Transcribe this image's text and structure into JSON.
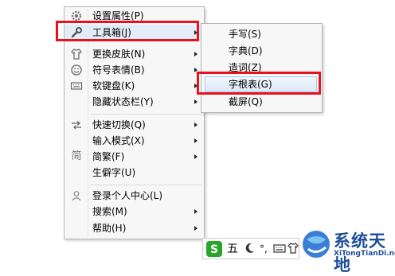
{
  "main_menu": {
    "items": [
      {
        "label": "设置属性(P)",
        "icon": "gear-icon",
        "submenu": false
      },
      {
        "label": "工具箱(J)",
        "icon": "wrench-icon",
        "submenu": true
      },
      {
        "label": "更换皮肤(N)",
        "icon": "shirt-icon",
        "submenu": true
      },
      {
        "label": "符号表情(B)",
        "icon": "smiley-icon",
        "submenu": true
      },
      {
        "label": "软键盘(K)",
        "icon": "keyboard-icon",
        "submenu": true
      },
      {
        "label": "隐藏状态栏(Y)",
        "icon": "",
        "submenu": true
      },
      {
        "label": "快速切换(Q)",
        "icon": "switch-arrows-icon",
        "submenu": true
      },
      {
        "label": "输入模式(X)",
        "icon": "",
        "submenu": true
      },
      {
        "label": "简繁(F)",
        "icon": "simplified-char-icon",
        "icon_text": "简",
        "submenu": true
      },
      {
        "label": "生僻字(U)",
        "icon": "",
        "submenu": false
      },
      {
        "label": "登录个人中心(L)",
        "icon": "user-icon",
        "submenu": false
      },
      {
        "label": "搜索(M)",
        "icon": "",
        "submenu": true
      },
      {
        "label": "帮助(H)",
        "icon": "",
        "submenu": true
      }
    ]
  },
  "toolbox_submenu": {
    "items": [
      {
        "label": "手写(S)"
      },
      {
        "label": "字典(D)"
      },
      {
        "label": "造词(Z)"
      },
      {
        "label": "字根表(G)"
      },
      {
        "label": "截屏(Q)"
      }
    ]
  },
  "ime_toolbar": {
    "logo_icon": "sogou-s-logo-icon",
    "mode_label": "五",
    "moon_icon": "moon-icon",
    "punct_label": "°,",
    "keyboard_icon": "keyboard-icon",
    "shirt_icon": "shirt-icon"
  },
  "watermark": {
    "title": "系统天地",
    "url": "XiTongTianDi.net"
  },
  "colors": {
    "highlight_box": "#e5131d",
    "selected_item_bg": "#dde9f8",
    "brand_blue": "#1f4d9a",
    "logo_green": "#2aa52a"
  }
}
